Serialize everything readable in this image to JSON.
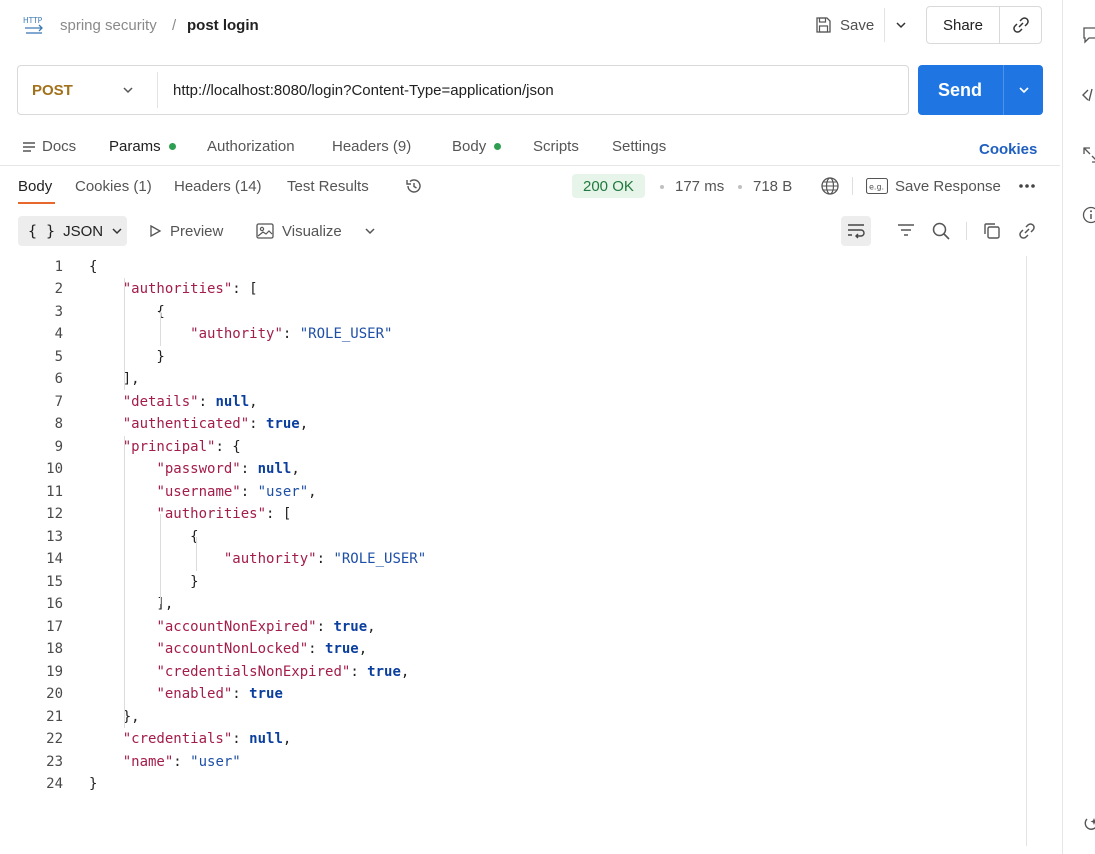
{
  "header": {
    "icon_text": "HTTP",
    "breadcrumb_parent": "spring security",
    "breadcrumb_separator": "/",
    "breadcrumb_current": "post login",
    "save_label": "Save",
    "share_label": "Share"
  },
  "request": {
    "method": "POST",
    "url": "http://localhost:8080/login?Content-Type=application/json",
    "send_label": "Send"
  },
  "request_tabs": [
    {
      "label": "Docs",
      "has_dot": false
    },
    {
      "label": "Params",
      "has_dot": true
    },
    {
      "label": "Authorization",
      "has_dot": false
    },
    {
      "label": "Headers (9)",
      "has_dot": false
    },
    {
      "label": "Body",
      "has_dot": true
    },
    {
      "label": "Scripts",
      "has_dot": false
    },
    {
      "label": "Settings",
      "has_dot": false
    }
  ],
  "cookies_link": "Cookies",
  "response_tabs": [
    {
      "label": "Body",
      "active": true
    },
    {
      "label": "Cookies (1)",
      "active": false
    },
    {
      "label": "Headers (14)",
      "active": false
    },
    {
      "label": "Test Results",
      "active": false
    }
  ],
  "response_meta": {
    "status": "200 OK",
    "time": "177 ms",
    "size": "718 B",
    "save_response_label": "Save Response",
    "save_response_icon_text": "e.g."
  },
  "response_toolbar": {
    "format_label": "JSON",
    "preview_label": "Preview",
    "visualize_label": "Visualize"
  },
  "code_lines": [
    "1",
    "2",
    "3",
    "4",
    "5",
    "6",
    "7",
    "8",
    "9",
    "10",
    "11",
    "12",
    "13",
    "14",
    "15",
    "16",
    "17",
    "18",
    "19",
    "20",
    "21",
    "22",
    "23",
    "24"
  ],
  "json": {
    "authorities": "\"authorities\"",
    "authority": "\"authority\"",
    "role_user": "\"ROLE_USER\"",
    "details": "\"details\"",
    "authenticated": "\"authenticated\"",
    "principal": "\"principal\"",
    "password": "\"password\"",
    "username": "\"username\"",
    "user": "\"user\"",
    "accountNonExpired": "\"accountNonExpired\"",
    "accountNonLocked": "\"accountNonLocked\"",
    "credentialsNonExpired": "\"credentialsNonExpired\"",
    "enabled": "\"enabled\"",
    "credentials": "\"credentials\"",
    "name": "\"name\"",
    "null": "null",
    "true": "true"
  },
  "colors": {
    "send_blue": "#1f76e3",
    "method_post": "#a2711b",
    "status_green": "#207a3c",
    "active_tab_underline": "#e8672a",
    "json_key": "#a31d4a",
    "json_string": "#1e4fa6"
  }
}
